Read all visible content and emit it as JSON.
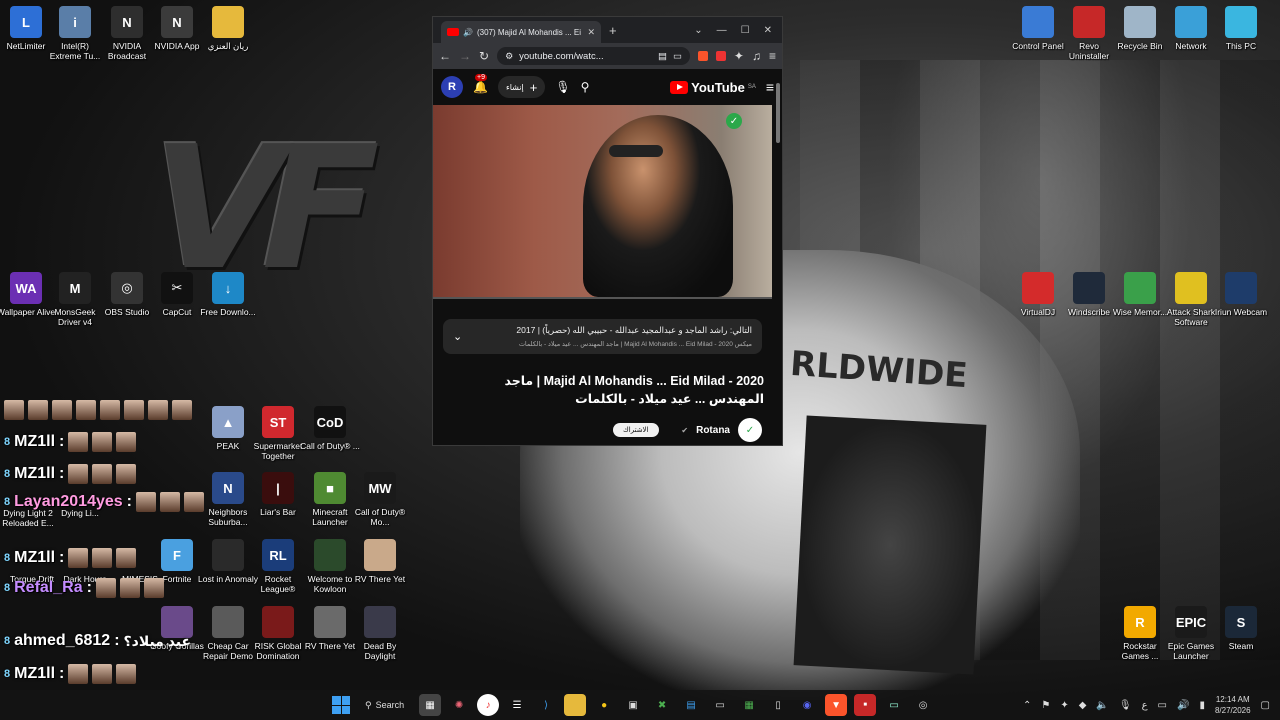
{
  "desktop_icons_left_top": [
    {
      "label": "NetLimiter",
      "icon": "netlimiter-icon",
      "color": "#2d6fd6",
      "glyph": "L"
    },
    {
      "label": "Intel(R) Extreme Tu...",
      "icon": "intel-xtu-icon",
      "color": "#5a7ea8",
      "glyph": "i"
    },
    {
      "label": "NVIDIA Broadcast",
      "icon": "nvidia-broadcast-icon",
      "color": "#2e2e2e",
      "glyph": "N"
    },
    {
      "label": "NVIDIA App",
      "icon": "nvidia-app-icon",
      "color": "#3b3b3b",
      "glyph": "N"
    },
    {
      "label": "ريان العنزي",
      "icon": "folder-icon",
      "color": "#e6b93c",
      "glyph": ""
    }
  ],
  "desktop_icons_left_mid": [
    {
      "label": "Wallpaper Alive",
      "icon": "wallpaper-alive-icon",
      "color": "#6b2fb3",
      "glyph": "WA"
    },
    {
      "label": "MonsGeek Driver v4",
      "icon": "monsgeek-icon",
      "color": "#222222",
      "glyph": "M"
    },
    {
      "label": "OBS Studio",
      "icon": "obs-icon",
      "color": "#333333",
      "glyph": "◎"
    },
    {
      "label": "CapCut",
      "icon": "capcut-icon",
      "color": "#111111",
      "glyph": "✂"
    },
    {
      "label": "Free Downlo...",
      "icon": "free-download-icon",
      "color": "#1e88c7",
      "glyph": "↓"
    }
  ],
  "desktop_icons_games": [
    {
      "label": "PEAK",
      "icon": "peak-icon",
      "color": "#8aa0c8",
      "glyph": "▲"
    },
    {
      "label": "Supermarket Together",
      "icon": "supermarket-icon",
      "color": "#d0282e",
      "glyph": "ST"
    },
    {
      "label": "Call of Duty® ...",
      "icon": "cod-icon",
      "color": "#111111",
      "glyph": "CoD"
    },
    {
      "label": "Neighbors Suburba...",
      "icon": "neighbors-icon",
      "color": "#2a4a8a",
      "glyph": "N"
    },
    {
      "label": "Liar's Bar",
      "icon": "liars-bar-icon",
      "color": "#3a0d0d",
      "glyph": "|"
    },
    {
      "label": "Minecraft Launcher",
      "icon": "minecraft-icon",
      "color": "#4f8a32",
      "glyph": "■"
    },
    {
      "label": "Call of Duty® Mo...",
      "icon": "cod-mw-icon",
      "color": "#1a1a1a",
      "glyph": "MW"
    },
    {
      "label": "Fortnite",
      "icon": "fortnite-icon",
      "color": "#4aa0e0",
      "glyph": "F"
    },
    {
      "label": "Lost in Anomaly",
      "icon": "lost-anomaly-icon",
      "color": "#2a2a2a",
      "glyph": ""
    },
    {
      "label": "Rocket League®",
      "icon": "rocket-league-icon",
      "color": "#1b3d7a",
      "glyph": "RL"
    },
    {
      "label": "Welcome to Kowloon",
      "icon": "kowloon-icon",
      "color": "#2b4a2b",
      "glyph": ""
    },
    {
      "label": "RV There Yet",
      "icon": "rv-there-yet-icon",
      "color": "#c9a98a",
      "glyph": ""
    },
    {
      "label": "Goofy Gorillas",
      "icon": "goofy-gorillas-icon",
      "color": "#6a4a8a",
      "glyph": ""
    },
    {
      "label": "Cheap Car Repair Demo",
      "icon": "cheap-car-icon",
      "color": "#5a5a5a",
      "glyph": ""
    },
    {
      "label": "RISK Global Domination",
      "icon": "risk-icon",
      "color": "#7a1a1a",
      "glyph": ""
    },
    {
      "label": "RV There Yet",
      "icon": "rv-there-yet-2-icon",
      "color": "#6a6a6a",
      "glyph": ""
    },
    {
      "label": "Dead By Daylight",
      "icon": "dbd-icon",
      "color": "#3a3a4a",
      "glyph": ""
    }
  ],
  "desktop_icons_left_partial": [
    {
      "label": "Torque Drift"
    },
    {
      "label": "Dark Hours"
    },
    {
      "label": "MIMESIS"
    },
    {
      "label": "Dying Light 2 Reloaded E..."
    },
    {
      "label": "Dying Li..."
    }
  ],
  "desktop_icons_right_top": [
    {
      "label": "Control Panel",
      "icon": "control-panel-icon",
      "color": "#3a7bd5"
    },
    {
      "label": "Revo Uninstaller",
      "icon": "revo-uninstaller-icon",
      "color": "#c62828"
    },
    {
      "label": "Recycle Bin",
      "icon": "recycle-bin-icon",
      "color": "#9fb5c8"
    },
    {
      "label": "Network",
      "icon": "network-icon",
      "color": "#3aa0d8"
    },
    {
      "label": "This PC",
      "icon": "this-pc-icon",
      "color": "#3ab6e0"
    }
  ],
  "desktop_icons_right_mid": [
    {
      "label": "VirtualDJ",
      "icon": "virtualdj-icon",
      "color": "#d42b2b"
    },
    {
      "label": "Windscribe",
      "icon": "windscribe-icon",
      "color": "#1f2a3a"
    },
    {
      "label": "Wise Memor...",
      "icon": "wise-memory-icon",
      "color": "#3aa04a"
    },
    {
      "label": "Attack Shark Software",
      "icon": "attack-shark-icon",
      "color": "#e0c020"
    },
    {
      "label": "Iriun Webcam",
      "icon": "iriun-webcam-icon",
      "color": "#1e3c6a"
    }
  ],
  "desktop_icons_right_bottom": [
    {
      "label": "Rockstar Games ...",
      "icon": "rockstar-icon",
      "color": "#f2a900",
      "glyph": "R"
    },
    {
      "label": "Epic Games Launcher",
      "icon": "epic-games-icon",
      "color": "#1a1a1a",
      "glyph": "EPIC"
    },
    {
      "label": "Steam",
      "icon": "steam-icon",
      "color": "#1b2838",
      "glyph": "S"
    }
  ],
  "browser": {
    "tab_title": "(307) Majid Al Mohandis ... Ei",
    "url": "youtube.com/watc...",
    "avatar_letter": "R",
    "notification_count": "+9",
    "create_label": "إنشاء",
    "logo_text": "YouTube",
    "logo_region": "SA",
    "description_line1": "التالي: راشد الماجد و عبدالمجيد عبدالله - حبيبي الله (حصرياً) | 2017",
    "description_line2": "ميكس Majid Al Mohandis ... Eid Milad - 2020 | ماجد المهندس ... عيد ميلاد - بالكلمات",
    "video_title": "Majid Al Mohandis ... Eid Milad - 2020 | ماجد المهندس ... عيد ميلاد - بالكلمات",
    "channel_name": "Rotana",
    "subscribe_label": "الاشتراك",
    "progress_fraction": 0.0
  },
  "wallpaper_text": {
    "shirt": "RLDWIDE",
    "logo": "VF"
  },
  "chat": [
    {
      "user": "",
      "badge": "",
      "message": ""
    },
    {
      "user": "MZ1ll",
      "badge": "8",
      "message": ""
    },
    {
      "user": "MZ1ll",
      "badge": "8",
      "message": ""
    },
    {
      "user": "Layan2014yes",
      "badge": "8",
      "message": ""
    },
    {
      "user": "MZ1ll",
      "badge": "8",
      "message": ""
    },
    {
      "user": "Refal_Ra",
      "badge": "8",
      "message": ""
    },
    {
      "user": "ahmed_6812",
      "badge": "8",
      "message": "عيد ميلاد؟"
    },
    {
      "user": "MZ1ll",
      "badge": "8",
      "message": ""
    }
  ],
  "taskbar": {
    "search_label": "Search",
    "time": "12:14 AM",
    "date": "8/27/2026",
    "lang": "ع"
  },
  "colors": {
    "accent_red": "#ff0000",
    "windows_blue": "#3ea0f2"
  }
}
